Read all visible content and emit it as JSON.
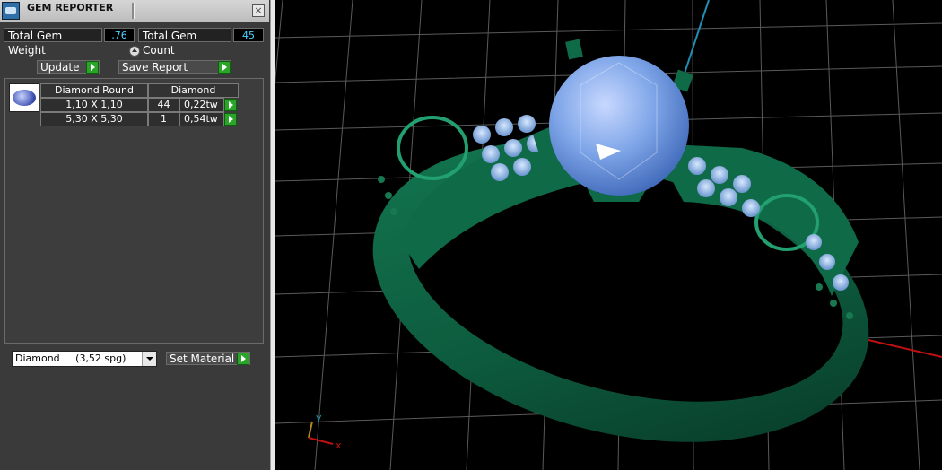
{
  "window": {
    "title": "GEM REPORTER",
    "close_icon": "×"
  },
  "stats": {
    "total_weight_label": "Total Gem Weight",
    "total_weight_value": ",76",
    "total_count_label": "Total Gem Count",
    "total_count_value": "45"
  },
  "toolbar": {
    "update_label": "Update",
    "save_label": "Save Report"
  },
  "gem_table": {
    "headers": [
      "Diamond Round",
      "Diamond"
    ],
    "rows": [
      {
        "size": "1,10 X 1,10",
        "count": "44",
        "weight": "0,22tw"
      },
      {
        "size": "5,30 X 5,30",
        "count": "1",
        "weight": "0,54tw"
      }
    ]
  },
  "material": {
    "selected": "Diamond     (3,52 spg)",
    "set_label": "Set Material"
  },
  "axes": {
    "x": "x",
    "y": "y"
  },
  "colors": {
    "metal": "#0e5b3f",
    "gem": "#7fa6e8",
    "accent_green": "#2aa52a",
    "value_text": "#4fd3ff",
    "y_axis": "#1f8fb5",
    "x_axis": "#c01010"
  }
}
